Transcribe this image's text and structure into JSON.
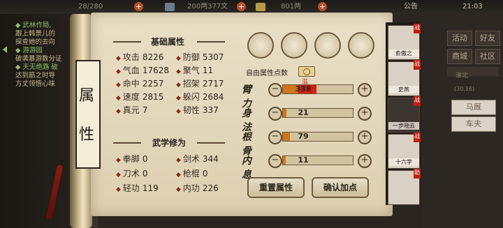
{
  "topbar": {
    "stamina": "28/280",
    "silver": "200两377文",
    "gold": "801两",
    "announcement": "公告",
    "clock": "21:03"
  },
  "quests": [
    {
      "text": "◆ 武林作局,",
      "green": true
    },
    {
      "text": "  跟上韩景儿的",
      "green": false
    },
    {
      "text": "  探查她的去向",
      "green": false
    },
    {
      "text": "◆ 游游园",
      "green": true
    },
    {
      "text": "  破袭暴游数分证",
      "green": false
    },
    {
      "text": "◆ 天无绝路 破",
      "green": true
    },
    {
      "text": "  达到筋之时导",
      "green": false
    },
    {
      "text": "  方丈领悟心味",
      "green": false
    }
  ],
  "title": "属性",
  "basic": {
    "heading": "基础属性",
    "stats": [
      {
        "label": "攻击",
        "value": "8226"
      },
      {
        "label": "防御",
        "value": "5307"
      },
      {
        "label": "气血",
        "value": "17628"
      },
      {
        "label": "聚气",
        "value": "11"
      },
      {
        "label": "命中",
        "value": "2257"
      },
      {
        "label": "招架",
        "value": "2717"
      },
      {
        "label": "速度",
        "value": "2815"
      },
      {
        "label": "躲闪",
        "value": "2684"
      },
      {
        "label": "真元",
        "value": "7"
      },
      {
        "label": "韧性",
        "value": "337"
      }
    ]
  },
  "martial": {
    "heading": "武学修为",
    "stats": [
      {
        "label": "拳脚",
        "value": "0"
      },
      {
        "label": "剑术",
        "value": "344"
      },
      {
        "label": "刀术",
        "value": "0"
      },
      {
        "label": "枪棍",
        "value": "0"
      },
      {
        "label": "轻功",
        "value": "119"
      },
      {
        "label": "内功",
        "value": "226"
      }
    ]
  },
  "icons": [
    "character-portrait-icon",
    "scroll-book-icon",
    "yin-yang-icon",
    "meditation-figure-icon"
  ],
  "free_points_label": "自由属性点数",
  "attributes": [
    {
      "name": "臂力",
      "value": "338",
      "fill": 0.22,
      "overflow": 0.26,
      "overflow_label": "溢出",
      "color": "#d0751d"
    },
    {
      "name": "身法",
      "value": "21",
      "fill": 0.05,
      "overflow": 0,
      "overflow_label": "",
      "color": "#d0751d"
    },
    {
      "name": "根骨",
      "value": "79",
      "fill": 0.1,
      "overflow": 0,
      "overflow_label": "",
      "color": "#d0751d"
    },
    {
      "name": "内息",
      "value": "11",
      "fill": 0.04,
      "overflow": 0,
      "overflow_label": "",
      "color": "#d0751d"
    }
  ],
  "buttons": {
    "reset": "重置属性",
    "confirm": "确认加点"
  },
  "party": [
    {
      "name": "俞傲之",
      "tag": "战"
    },
    {
      "name": "史燕",
      "tag": "战"
    },
    {
      "name": "一步晓云",
      "tag": "战"
    },
    {
      "name": "十六字",
      "tag": "战"
    },
    {
      "name": "",
      "tag": "助"
    }
  ],
  "menu": {
    "row1": [
      "活动",
      "好友"
    ],
    "row2": [
      "商城",
      "社区"
    ],
    "location": "淮北",
    "coords": "(30,16)",
    "horse": "马厩",
    "cart": "车夫"
  }
}
